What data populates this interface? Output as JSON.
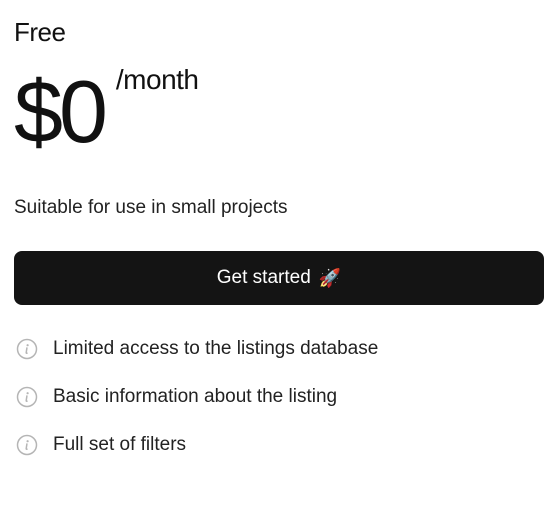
{
  "plan": {
    "name": "Free",
    "price": "$0",
    "period": "/month",
    "description": "Suitable for use in small projects",
    "cta_label": "Get started",
    "cta_emoji": "🚀",
    "features": [
      {
        "label": "Limited access to the listings database",
        "icon": "info-icon"
      },
      {
        "label": "Basic information about the listing",
        "icon": "info-icon"
      },
      {
        "label": "Full set of filters",
        "icon": "info-icon"
      }
    ]
  },
  "colors": {
    "button_bg": "#141414",
    "button_text": "#ffffff",
    "text": "#111111",
    "icon": "#b5b5b5"
  }
}
